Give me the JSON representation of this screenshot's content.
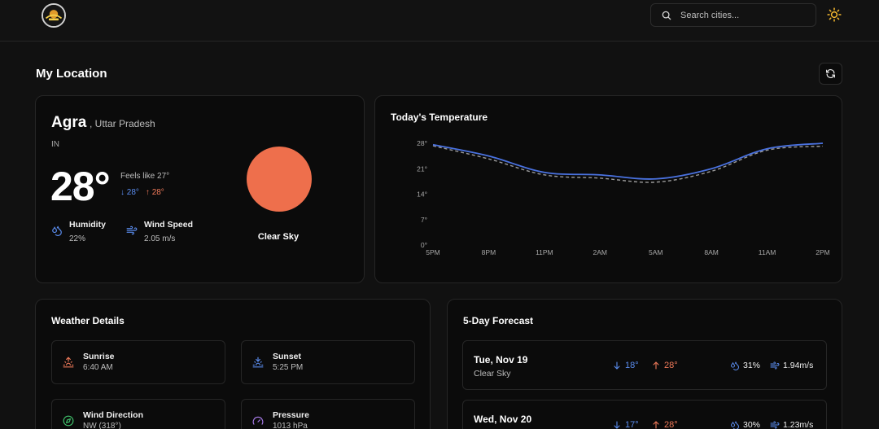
{
  "header": {
    "search_placeholder": "Search cities...",
    "logo_icon": "weather-hub-logo",
    "search_icon": "search-icon",
    "theme_icon": "sun-icon"
  },
  "section": {
    "title": "My Location",
    "refresh_icon": "refresh-icon"
  },
  "current": {
    "city": "Agra",
    "state": ", Uttar Pradesh",
    "country": "IN",
    "temp": "28°",
    "feels_like": "Feels like 27°",
    "min": "28°",
    "max": "28°",
    "humidity_label": "Humidity",
    "humidity_value": "22%",
    "wind_label": "Wind Speed",
    "wind_value": "2.05 m/s",
    "condition": "Clear Sky",
    "icon_color": "#ee6f4c"
  },
  "chart_title": "Today's Temperature",
  "chart_data": {
    "type": "line",
    "title": "Today's Temperature",
    "x": [
      "5PM",
      "8PM",
      "11PM",
      "2AM",
      "5AM",
      "8AM",
      "11AM",
      "2PM"
    ],
    "y_ticks": [
      "0°",
      "7°",
      "14°",
      "21°",
      "28°"
    ],
    "ylim": [
      0,
      28
    ],
    "series": [
      {
        "values": [
          27.6,
          24.5,
          20.0,
          19.3,
          18.2,
          21.0,
          26.5,
          28.0
        ],
        "color": "#4a72e0",
        "style": "solid"
      },
      {
        "values": [
          27.3,
          23.7,
          19.3,
          18.4,
          17.3,
          20.3,
          26.1,
          27.2
        ],
        "color": "#9a9a9a",
        "style": "dashed"
      }
    ],
    "grid": false
  },
  "details": {
    "title": "Weather Details",
    "items": [
      {
        "label": "Sunrise",
        "value": "6:40 AM",
        "icon": "sunrise-icon",
        "color": "#f07a5a"
      },
      {
        "label": "Sunset",
        "value": "5:25 PM",
        "icon": "sunset-icon",
        "color": "#5b8def"
      },
      {
        "label": "Wind Direction",
        "value": "NW (318°)",
        "icon": "compass-icon",
        "color": "#3fbf6a"
      },
      {
        "label": "Pressure",
        "value": "1013 hPa",
        "icon": "gauge-icon",
        "color": "#a77be8"
      }
    ]
  },
  "forecast": {
    "title": "5-Day Forecast",
    "days": [
      {
        "date": "Tue, Nov 19",
        "desc": "Clear Sky",
        "min": "18°",
        "max": "28°",
        "humidity": "31%",
        "wind": "1.94m/s"
      },
      {
        "date": "Wed, Nov 20",
        "desc": "",
        "min": "17°",
        "max": "28°",
        "humidity": "30%",
        "wind": "1.23m/s"
      }
    ]
  }
}
